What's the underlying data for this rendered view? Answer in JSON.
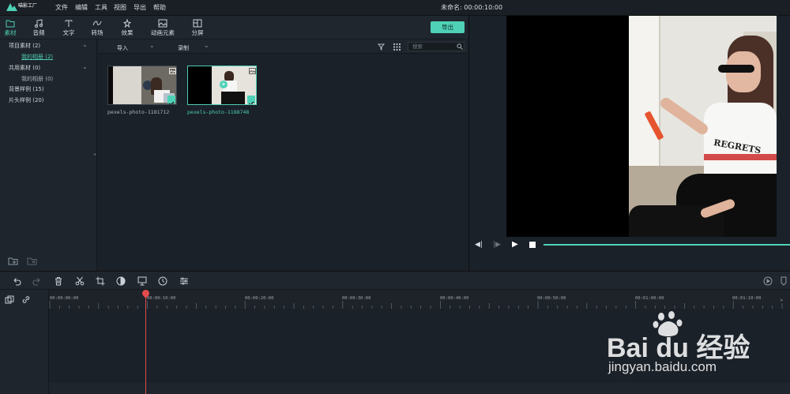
{
  "app": {
    "logo_text": "喵影工厂",
    "logo_subtext": "filmora",
    "title": "未命名: 00:00:10:00"
  },
  "menu": [
    "文件",
    "编辑",
    "工具",
    "视图",
    "导出",
    "帮助"
  ],
  "tabs": [
    {
      "label": "素材",
      "icon": "folder-icon",
      "active": true
    },
    {
      "label": "音频",
      "icon": "music-note-icon",
      "active": false
    },
    {
      "label": "文字",
      "icon": "text-icon",
      "active": false
    },
    {
      "label": "转场",
      "icon": "transition-icon",
      "active": false
    },
    {
      "label": "效果",
      "icon": "effects-icon",
      "active": false
    },
    {
      "label": "动画元素",
      "icon": "image-icon",
      "active": false
    },
    {
      "label": "分屏",
      "icon": "split-screen-icon",
      "active": false
    }
  ],
  "export_label": "导出",
  "sidebar": {
    "items": [
      {
        "label": "项目素材 (2)",
        "expandable": true
      },
      {
        "label": "我的相册 (2)",
        "sub": true,
        "active": true
      },
      {
        "label": "共用素材 (0)",
        "expandable": true
      },
      {
        "label": "我的相册 (0)",
        "sub": true
      },
      {
        "label": "背景样例 (15)"
      },
      {
        "label": "片头样例 (20)"
      }
    ]
  },
  "media_toolbar": {
    "import_label": "导入",
    "record_label": "录制",
    "search_placeholder": "搜索"
  },
  "media_items": [
    {
      "label": "pexels-photo-1181712",
      "selected": false
    },
    {
      "label": "pexels-photo-1188748",
      "selected": true
    }
  ],
  "ruler_labels": [
    "00:00:00:00",
    "00:00:10:00",
    "00:00:20:00",
    "00:00:30:00",
    "00:00:40:00",
    "00:00:50:00",
    "00:01:00:00",
    "00:01:10:00"
  ],
  "colors": {
    "accent": "#4fd1b8",
    "playhead": "#e24b4b",
    "background": "#1b2128"
  },
  "watermark": {
    "brand": "Bai du 经验",
    "url": "jingyan.baidu.com"
  }
}
